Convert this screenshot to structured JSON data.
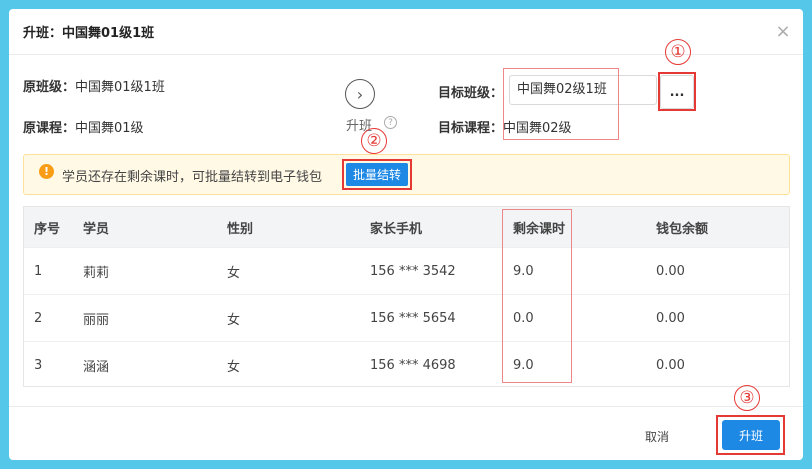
{
  "dialog": {
    "title": "升班：中国舞01级1班",
    "close_icon": "×"
  },
  "original": {
    "class_label": "原班级：",
    "class_value": "中国舞01级1班",
    "course_label": "原课程：",
    "course_value": "中国舞01级"
  },
  "upgrade": {
    "arrow_icon": "›",
    "label": "升班",
    "help_icon": "?"
  },
  "target": {
    "class_label": "目标班级：",
    "class_value": "中国舞02级1班",
    "select_button": "...",
    "course_label": "目标课程：",
    "course_value": "中国舞02级"
  },
  "alert": {
    "icon": "!",
    "text": "学员还存在剩余课时，可批量结转到电子钱包",
    "button": "批量结转"
  },
  "table": {
    "headers": [
      "序号",
      "学员",
      "性别",
      "家长手机",
      "剩余课时",
      "钱包余额"
    ],
    "rows": [
      [
        "1",
        "莉莉",
        "女",
        "156 *** 3542",
        "9.0",
        "0.00"
      ],
      [
        "2",
        "丽丽",
        "女",
        "156 *** 5654",
        "0.0",
        "0.00"
      ],
      [
        "3",
        "涵涵",
        "女",
        "156 *** 4698",
        "9.0",
        "0.00"
      ]
    ]
  },
  "annotations": [
    "①",
    "②",
    "③"
  ],
  "footer": {
    "cancel": "取消",
    "confirm": "升班"
  },
  "colors": {
    "primary": "#1e88e5",
    "annotation": "#e53935",
    "alert_bg": "#fff9e6",
    "background": "#55c8ea"
  }
}
